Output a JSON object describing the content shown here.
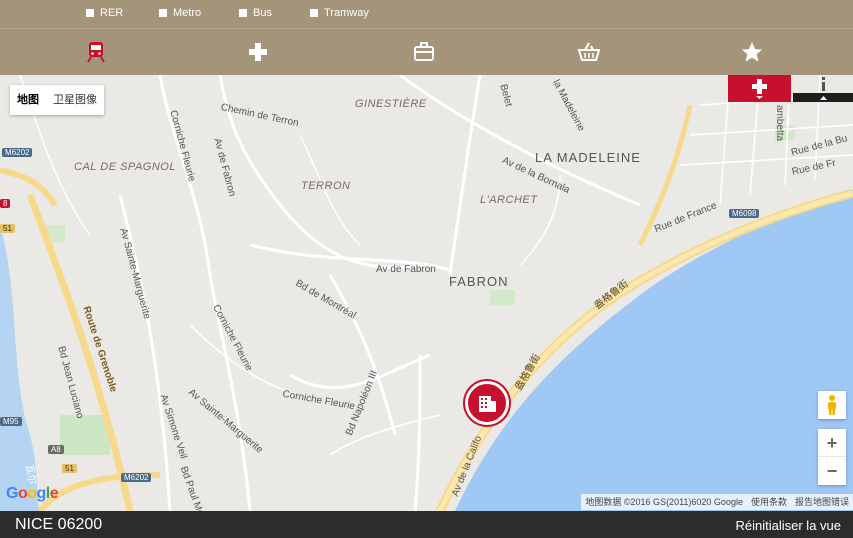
{
  "filters": [
    {
      "label": "RER"
    },
    {
      "label": "Metro"
    },
    {
      "label": "Bus"
    },
    {
      "label": "Tramway"
    }
  ],
  "categories": [
    {
      "icon": "train-icon",
      "active": true
    },
    {
      "icon": "medical-cross-icon",
      "active": false
    },
    {
      "icon": "briefcase-icon",
      "active": false
    },
    {
      "icon": "shopping-basket-icon",
      "active": false
    },
    {
      "icon": "star-icon",
      "active": false
    }
  ],
  "colors": {
    "bar_bg": "#a4957a",
    "accent": "#c8102e",
    "footer_bg": "#2c2c2c",
    "sea": "#9fc8f5"
  },
  "map": {
    "type_buttons": {
      "map": "地图",
      "satellite": "卫星图像"
    },
    "labels": {
      "ginestiere": "GINESTIÈRE",
      "la_madeleine": "LA MADELEINE",
      "cal_de_spagnol": "CAL DE SPAGNOL",
      "terron": "TERRON",
      "larchet": "L'ARCHET",
      "fabron": "FABRON",
      "chemin_terron": "Chemin de Terron",
      "av_fabron": "Av de Fabron",
      "av_fabron2": "Av de Fabron",
      "corniche_fleurie1": "Corniche Fleurie",
      "corniche_fleurie2": "Corniche Fleurie",
      "corniche_fleurie3": "Corniche Fleurie",
      "av_bornala": "Av de la Bornala",
      "rue_france": "Rue de France",
      "rue_bu": "Rue de la Bu",
      "rue_fr": "Rue de Fr",
      "bd_montreal": "Bd de Montréal",
      "av_ste_marguerite1": "Av Sainte-Marguerite",
      "av_ste_marguerite2": "Av Sainte-Marguerite",
      "route_grenoble": "Route de Grenoble",
      "bd_jean_luciano": "Bd Jean Luciano",
      "av_simone_veil": "Av Simone Veil",
      "bd_paul_mo": "Bd Paul Mo",
      "bd_napoleon": "Bd Napoléon III",
      "av_california": "Av de la Califo",
      "promenade1": "盎格鲁街",
      "promenade2": "盎格鲁街",
      "belet": "Belet",
      "madeleine_rd": "la Madeleine",
      "gambetta": "ambetta",
      "m6202a": "M6202",
      "m6202b": "M6202",
      "m6098": "M6098",
      "m95": "M95",
      "a8": "A8",
      "r51": "51",
      "r51b": "51",
      "n8": "8",
      "var_cn": "瓦尔"
    },
    "attribution": {
      "data": "地图数据 ©2016 GS(2011)6020 Google",
      "terms": "使用条款",
      "report": "报告地图错误"
    },
    "google": "Google"
  },
  "controls": {
    "zoom_in": "+",
    "zoom_out": "−"
  },
  "footer": {
    "location": "NICE 06200",
    "reset": "Réinitialiser la vue"
  }
}
